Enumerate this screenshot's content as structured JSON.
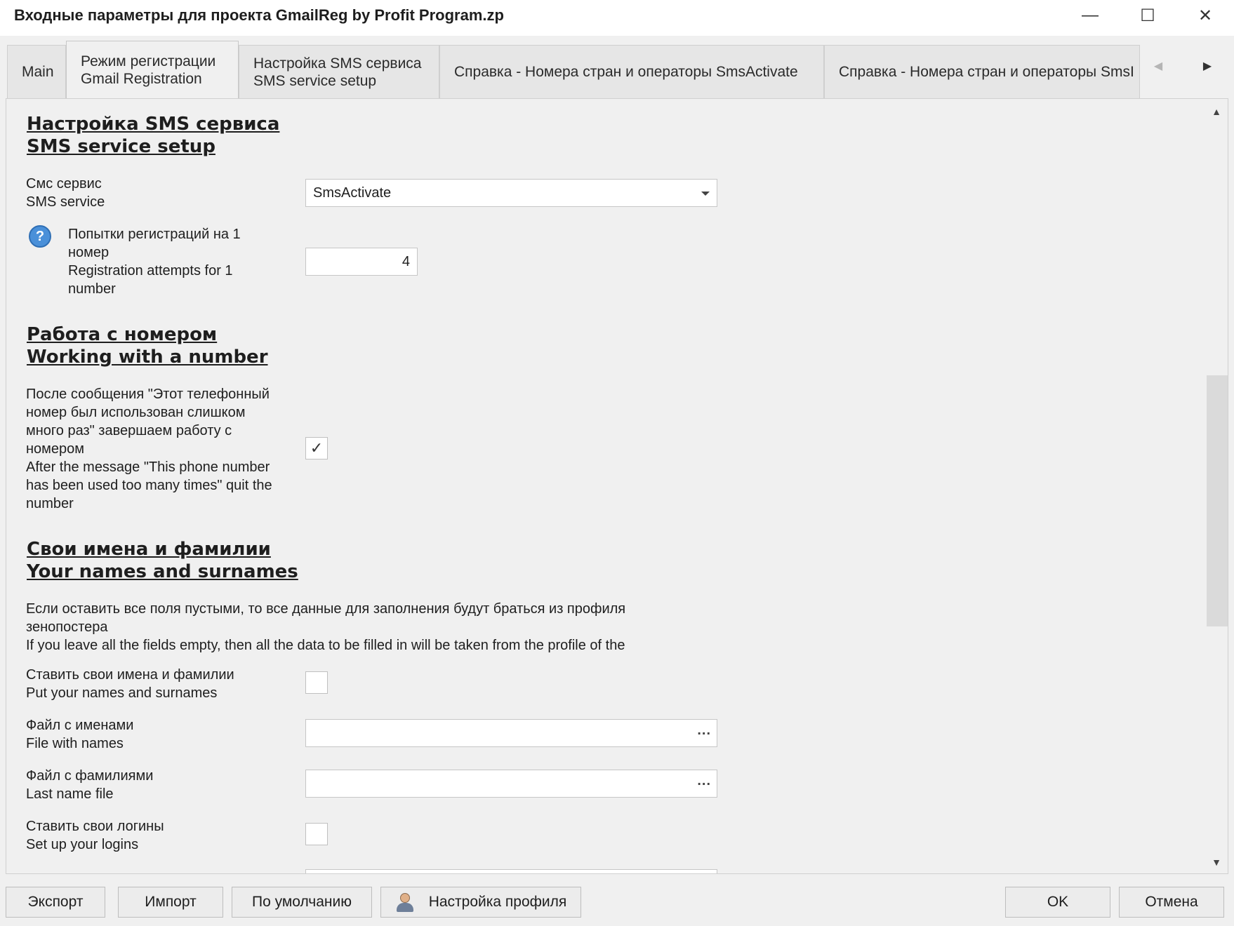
{
  "window": {
    "title": "Входные параметры для проекта GmailReg by Profit Program.zp",
    "minimize_glyph": "—",
    "maximize_glyph": "☐",
    "close_glyph": "✕"
  },
  "tabs": [
    {
      "line1": "Main",
      "line2": ""
    },
    {
      "line1": "Режим регистрации",
      "line2": "Gmail Registration"
    },
    {
      "line1": "Настройка SMS сервиса",
      "line2": "SMS service setup"
    },
    {
      "line1": "Справка - Номера стран и операторы SmsActivate",
      "line2": ""
    },
    {
      "line1": "Справка - Номера стран и операторы SmsI",
      "line2": ""
    }
  ],
  "tab_scroll": {
    "left_glyph": "◀",
    "right_glyph": "▶"
  },
  "scrollbar": {
    "up_glyph": "▲",
    "down_glyph": "▼"
  },
  "sections": {
    "sms": {
      "title1": "Настройка SMS сервиса",
      "title2": "SMS service setup"
    },
    "number": {
      "title1": "Работа с номером",
      "title2": "Working with a number"
    },
    "names": {
      "title1": "Свои имена и фамилии",
      "title2": "Your names and surnames"
    }
  },
  "fields": {
    "sms_service": {
      "label1": "Смс сервис",
      "label2": "SMS service",
      "value": "SmsActivate"
    },
    "attempts": {
      "label1": "Попытки регистраций на 1",
      "label2": "номер",
      "label3": "Registration attempts for 1",
      "label4": "number",
      "value": "4",
      "help_glyph": "?"
    },
    "quit_number": {
      "lines": [
        "После сообщения \"Этот телефонный",
        "номер был использован слишком",
        "много раз\" завершаем работу с",
        "номером",
        "After the message \"This phone number",
        "has been used too many times\" quit the",
        "number"
      ],
      "checked": true,
      "check_glyph": "✓"
    },
    "names_note": {
      "lines": [
        "Если оставить все поля пустыми, то все данные для заполнения будут браться из профиля",
        "зенопостера",
        "If you leave all the fields empty, then all the data to be filled in will be taken from the profile of the"
      ]
    },
    "put_names": {
      "label1": "Ставить свои имена и фамилии",
      "label2": "Put your names and surnames",
      "checked": false
    },
    "names_file": {
      "label1": "Файл с именами",
      "label2": "File with names",
      "value": "",
      "browse": "..."
    },
    "lastname_file": {
      "label1": "Файл с фамилиями",
      "label2": "Last name file",
      "value": "",
      "browse": "..."
    },
    "put_logins": {
      "label1": "Ставить свои логины",
      "label2": "Set up your logins",
      "checked": false
    }
  },
  "buttons": {
    "export": "Экспорт",
    "import": "Импорт",
    "default": "По умолчанию",
    "profile": "Настройка профиля",
    "ok": "OK",
    "cancel": "Отмена"
  }
}
